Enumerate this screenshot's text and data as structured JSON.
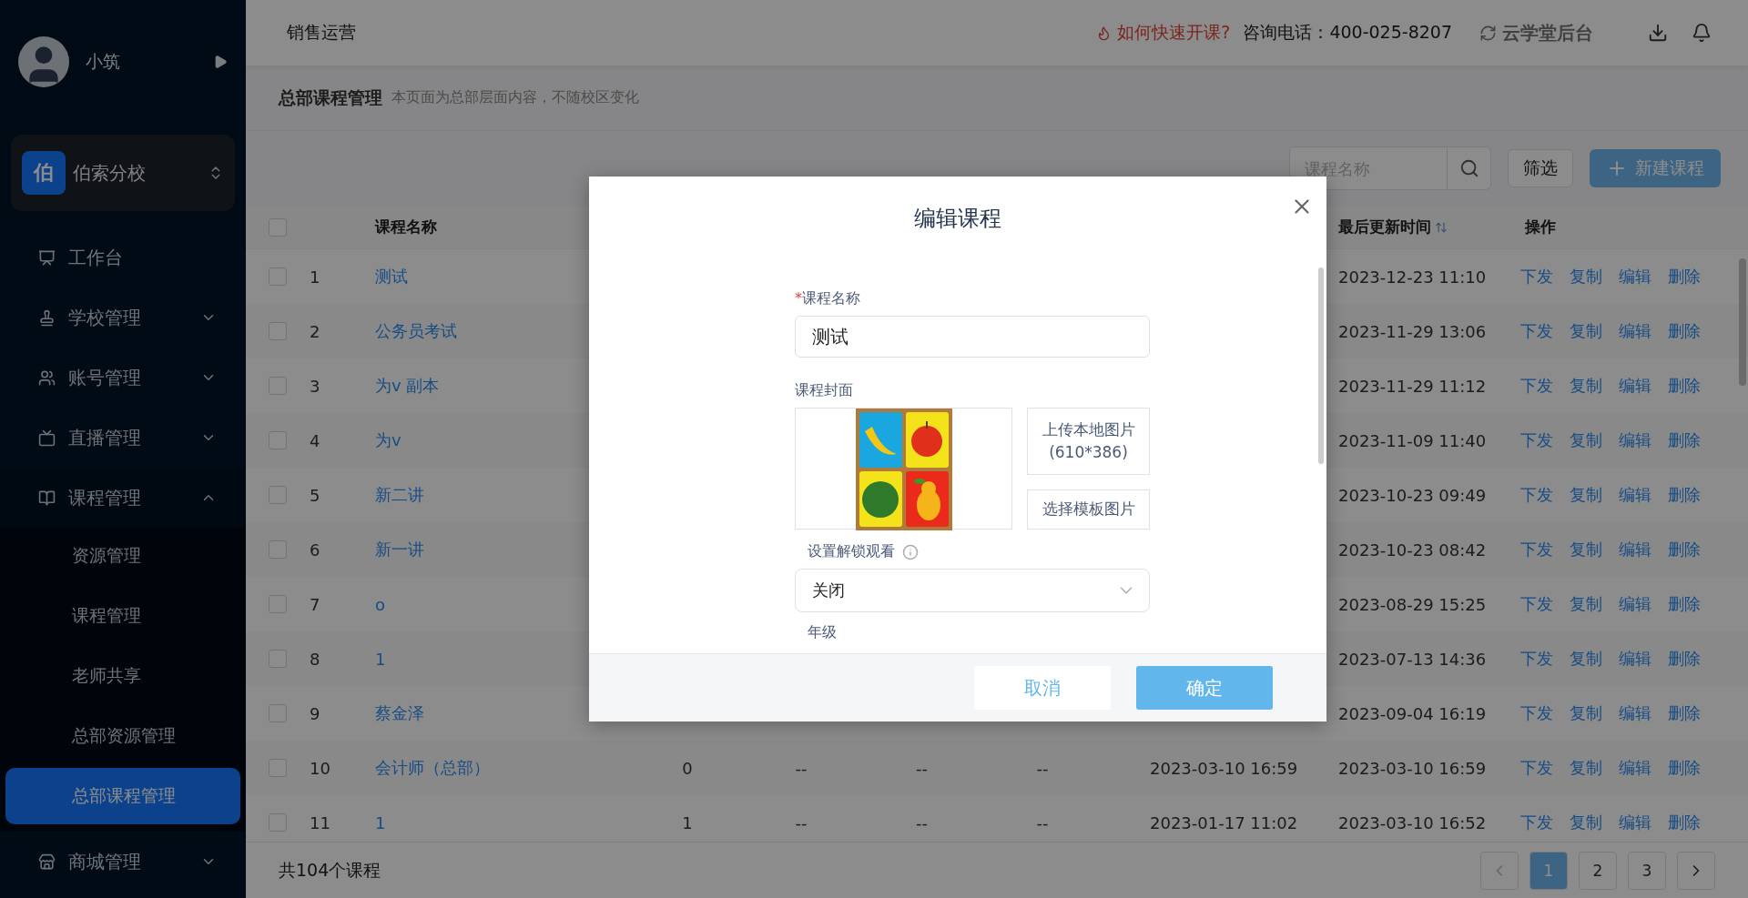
{
  "sidebar": {
    "user": {
      "name": "小筑"
    },
    "school": {
      "badge": "伯",
      "name": "伯索分校"
    },
    "menu": [
      {
        "label": "工作台",
        "kind": "link"
      },
      {
        "label": "学校管理",
        "kind": "group",
        "expanded": false
      },
      {
        "label": "账号管理",
        "kind": "group",
        "expanded": false
      },
      {
        "label": "直播管理",
        "kind": "group",
        "expanded": false
      },
      {
        "label": "课程管理",
        "kind": "group",
        "expanded": true,
        "children": [
          {
            "label": "资源管理",
            "selected": false
          },
          {
            "label": "课程管理",
            "selected": false
          },
          {
            "label": "老师共享",
            "selected": false
          },
          {
            "label": "总部资源管理",
            "selected": false
          },
          {
            "label": "总部课程管理",
            "selected": true
          }
        ]
      },
      {
        "label": "商城管理",
        "kind": "group",
        "expanded": false
      }
    ]
  },
  "topbar": {
    "title": "销售运营",
    "help_link": "如何快速开课?",
    "phone": "咨询电话：400-025-8207",
    "backend_link": "云学堂后台"
  },
  "page_header": {
    "title": "总部课程管理",
    "note": "本页面为总部层面内容，不随校区变化"
  },
  "toolbar": {
    "search": {
      "placeholder": "课程名称"
    },
    "filter_button": "筛选",
    "new_button": "新建课程"
  },
  "table": {
    "header_checked": false,
    "columns": [
      {
        "kind": "name",
        "label": "课程名称"
      },
      {
        "kind": "updated",
        "label": "最后更新时间",
        "sortable": true
      },
      {
        "kind": "actions",
        "label": "操作"
      }
    ],
    "rows": [
      {
        "checked": false,
        "index": "1",
        "name": "测试",
        "updated": "2023-12-23 11:10",
        "actions": [
          "下发",
          "复制",
          "编辑",
          "删除"
        ]
      },
      {
        "checked": false,
        "index": "2",
        "name": "公务员考试",
        "updated": "2023-11-29 13:06",
        "actions": [
          "下发",
          "复制",
          "编辑",
          "删除"
        ]
      },
      {
        "checked": false,
        "index": "3",
        "name": "为v 副本",
        "updated": "2023-11-29 11:12",
        "actions": [
          "下发",
          "复制",
          "编辑",
          "删除"
        ]
      },
      {
        "checked": false,
        "index": "4",
        "name": "为v",
        "updated": "2023-11-09 11:40",
        "actions": [
          "下发",
          "复制",
          "编辑",
          "删除"
        ]
      },
      {
        "checked": false,
        "index": "5",
        "name": "新二讲",
        "updated": "2023-10-23 09:49",
        "actions": [
          "下发",
          "复制",
          "编辑",
          "删除"
        ]
      },
      {
        "checked": false,
        "index": "6",
        "name": "新一讲",
        "updated": "2023-10-23 08:42",
        "actions": [
          "下发",
          "复制",
          "编辑",
          "删除"
        ]
      },
      {
        "checked": false,
        "index": "7",
        "name": "o",
        "updated": "2023-08-29 15:25",
        "actions": [
          "下发",
          "复制",
          "编辑",
          "删除"
        ]
      },
      {
        "checked": false,
        "index": "8",
        "name": "1",
        "updated": "2023-07-13 14:36",
        "actions": [
          "下发",
          "复制",
          "编辑",
          "删除"
        ]
      },
      {
        "checked": false,
        "index": "9",
        "name": "蔡金泽",
        "updated": "2023-09-04 16:19",
        "actions": [
          "下发",
          "复制",
          "编辑",
          "删除"
        ]
      },
      {
        "checked": false,
        "index": "10",
        "name": "会计师（总部）",
        "column_4": "0",
        "column_5": "--",
        "column_6": "--",
        "column_7": "--",
        "created": "2023-03-10 16:59",
        "updated": "2023-03-10 16:59",
        "actions": [
          "下发",
          "复制",
          "编辑",
          "删除"
        ]
      },
      {
        "checked": false,
        "index": "11",
        "name": "1",
        "column_4": "1",
        "column_5": "--",
        "column_6": "--",
        "column_7": "--",
        "created": "2023-01-17 11:02",
        "updated": "2023-03-10 16:52",
        "actions": [
          "下发",
          "复制",
          "编辑",
          "删除"
        ]
      }
    ]
  },
  "footer": {
    "total": "共104个课程",
    "pages": [
      {
        "label": "1",
        "selected": true
      },
      {
        "label": "2",
        "selected": false
      },
      {
        "label": "3",
        "selected": false
      }
    ],
    "prev_disabled": true,
    "next_disabled": false
  },
  "dialog": {
    "title": "编辑课程",
    "name_field": {
      "label": "课程名称",
      "required_mark": "*",
      "value": "测试"
    },
    "cover": {
      "label": "课程封面",
      "upload_button": "上传本地图片",
      "upload_hint": "(610*386)",
      "template_button": "选择模板图片"
    },
    "unlock": {
      "label": "设置解锁观看",
      "value": "关闭"
    },
    "grade_label": "年级",
    "cancel": "取消",
    "confirm": "确定"
  }
}
